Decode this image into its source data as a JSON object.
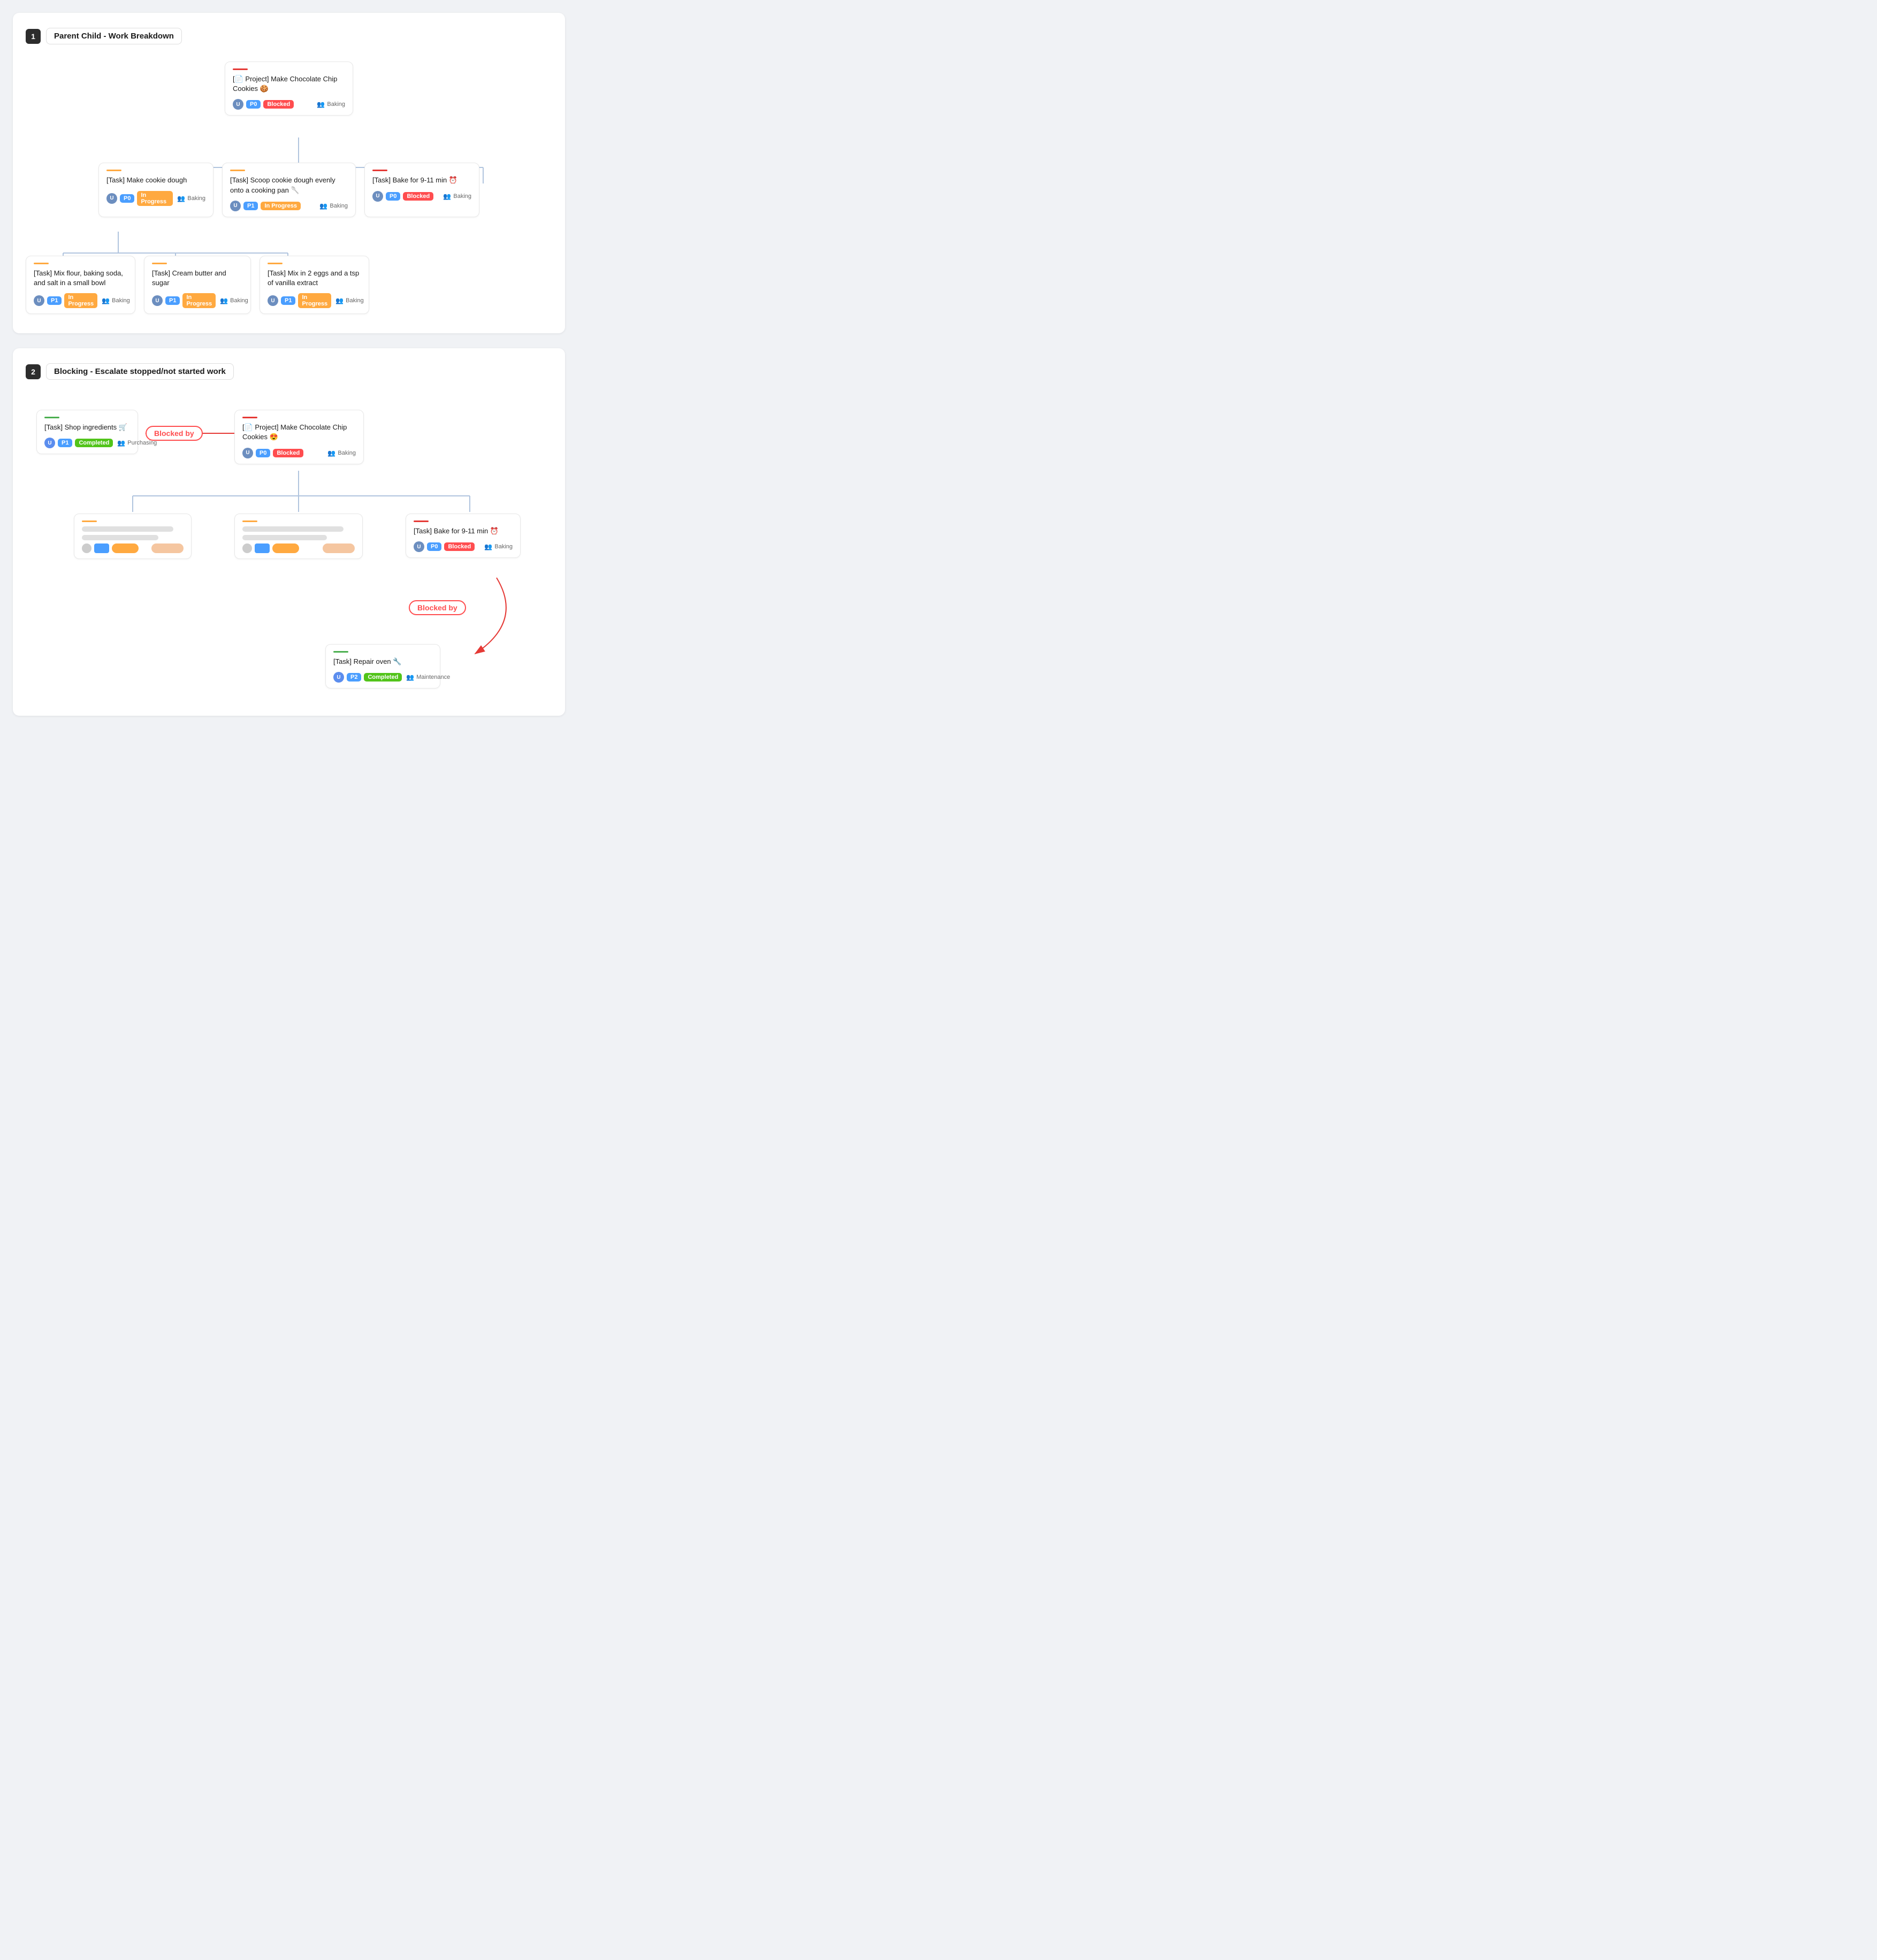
{
  "section1": {
    "number": "1",
    "title": "Parent Child - Work Breakdown",
    "root": {
      "accent": "#e53935",
      "title": "[📄 Project] Make Chocolate Chip Cookies 🍪",
      "avatar_color": "#6c8ebf",
      "avatar_letter": "U",
      "priority": "P0",
      "priority_class": "badge-p0",
      "status": "Blocked",
      "status_class": "badge-blocked",
      "team": "Baking"
    },
    "level1": [
      {
        "accent": "#ffa940",
        "title": "[Task] Make cookie dough",
        "avatar_color": "#6c8ebf",
        "avatar_letter": "U",
        "priority": "P0",
        "priority_class": "badge-p0",
        "status": "In Progress",
        "status_class": "badge-in-progress",
        "team": "Baking"
      },
      {
        "accent": "#ffa940",
        "title": "[Task] Scoop cookie dough evenly onto a cooking pan 🥄",
        "avatar_color": "#6c8ebf",
        "avatar_letter": "U",
        "priority": "P1",
        "priority_class": "badge-p1",
        "status": "In Progress",
        "status_class": "badge-in-progress",
        "team": "Baking"
      },
      {
        "accent": "#e53935",
        "title": "[Task] Bake for 9-11 min ⏰",
        "avatar_color": "#6c8ebf",
        "avatar_letter": "U",
        "priority": "P0",
        "priority_class": "badge-p0",
        "status": "Blocked",
        "status_class": "badge-blocked",
        "team": "Baking"
      }
    ],
    "level2": [
      {
        "accent": "#ffa940",
        "title": "[Task] Mix flour, baking soda, and salt in a small bowl",
        "avatar_color": "#6c8ebf",
        "avatar_letter": "U",
        "priority": "P1",
        "priority_class": "badge-p1",
        "status": "In Progress",
        "status_class": "badge-in-progress",
        "team": "Baking"
      },
      {
        "accent": "#ffa940",
        "title": "[Task] Cream butter and sugar",
        "avatar_color": "#6c8ebf",
        "avatar_letter": "U",
        "priority": "P1",
        "priority_class": "badge-p1",
        "status": "In Progress",
        "status_class": "badge-in-progress",
        "team": "Baking"
      },
      {
        "accent": "#ffa940",
        "title": "[Task] Mix in 2 eggs and a tsp of vanilla extract",
        "avatar_color": "#6c8ebf",
        "avatar_letter": "U",
        "priority": "P1",
        "priority_class": "badge-p1",
        "status": "In Progress",
        "status_class": "badge-in-progress",
        "team": "Baking"
      }
    ]
  },
  "section2": {
    "number": "2",
    "title": "Blocking - Escalate stopped/not started work",
    "shop_card": {
      "accent": "#4caf50",
      "title": "[Task] Shop ingredients 🛒",
      "avatar_color": "#5b8dee",
      "priority": "P1",
      "priority_class": "badge-p1",
      "status": "Completed",
      "status_class": "badge-completed",
      "team": "Purchasing"
    },
    "blocked_by_label1": "Blocked by",
    "project_card": {
      "accent": "#e53935",
      "title": "[📄 Project] Make Chocolate Chip Cookies 😍",
      "avatar_color": "#6c8ebf",
      "priority": "P0",
      "priority_class": "badge-p0",
      "status": "Blocked",
      "status_class": "badge-blocked",
      "team": "Baking"
    },
    "bake_card": {
      "accent": "#e53935",
      "title": "[Task] Bake for 9-11 min ⏰",
      "avatar_color": "#6c8ebf",
      "priority": "P0",
      "priority_class": "badge-p0",
      "status": "Blocked",
      "status_class": "badge-blocked",
      "team": "Baking"
    },
    "blocked_by_label2": "Blocked by",
    "repair_card": {
      "accent": "#4caf50",
      "title": "[Task] Repair oven 🔧",
      "avatar_color": "#5b8dee",
      "priority": "P2",
      "priority_class": "badge-p2",
      "status": "Completed",
      "status_class": "badge-completed",
      "team": "Maintenance"
    }
  }
}
